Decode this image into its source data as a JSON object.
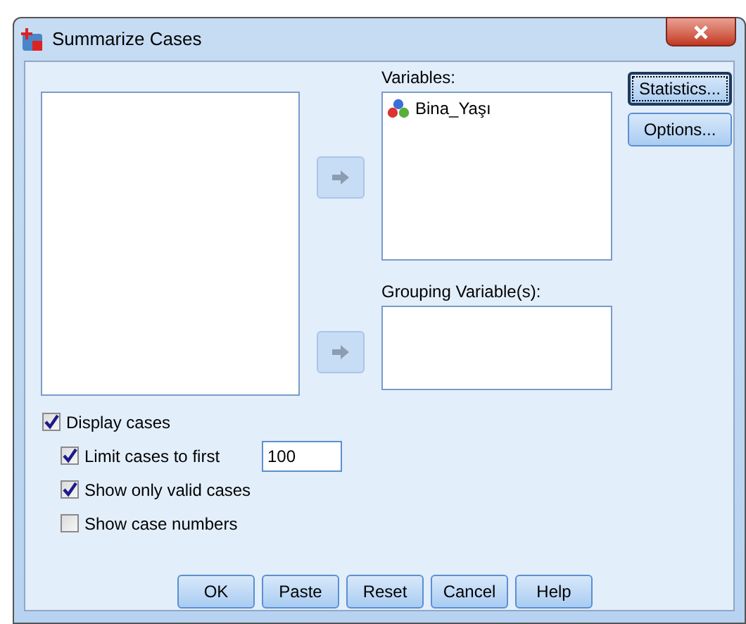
{
  "window": {
    "title": "Summarize Cases"
  },
  "variables": {
    "label": "Variables:",
    "items": [
      "Bina_Yaşı"
    ]
  },
  "grouping": {
    "label": "Grouping Variable(s):"
  },
  "side_buttons": [
    {
      "label": "Statistics...",
      "focused": true
    },
    {
      "label": "Options...",
      "focused": false
    }
  ],
  "options": [
    {
      "label": "Display cases",
      "checked": true,
      "children": [
        {
          "label": "Limit cases to first",
          "checked": true,
          "value": "100"
        },
        {
          "label": "Show only valid cases",
          "checked": true
        },
        {
          "label": "Show case numbers",
          "checked": false
        }
      ]
    }
  ],
  "buttons": [
    "OK",
    "Paste",
    "Reset",
    "Cancel",
    "Help"
  ]
}
